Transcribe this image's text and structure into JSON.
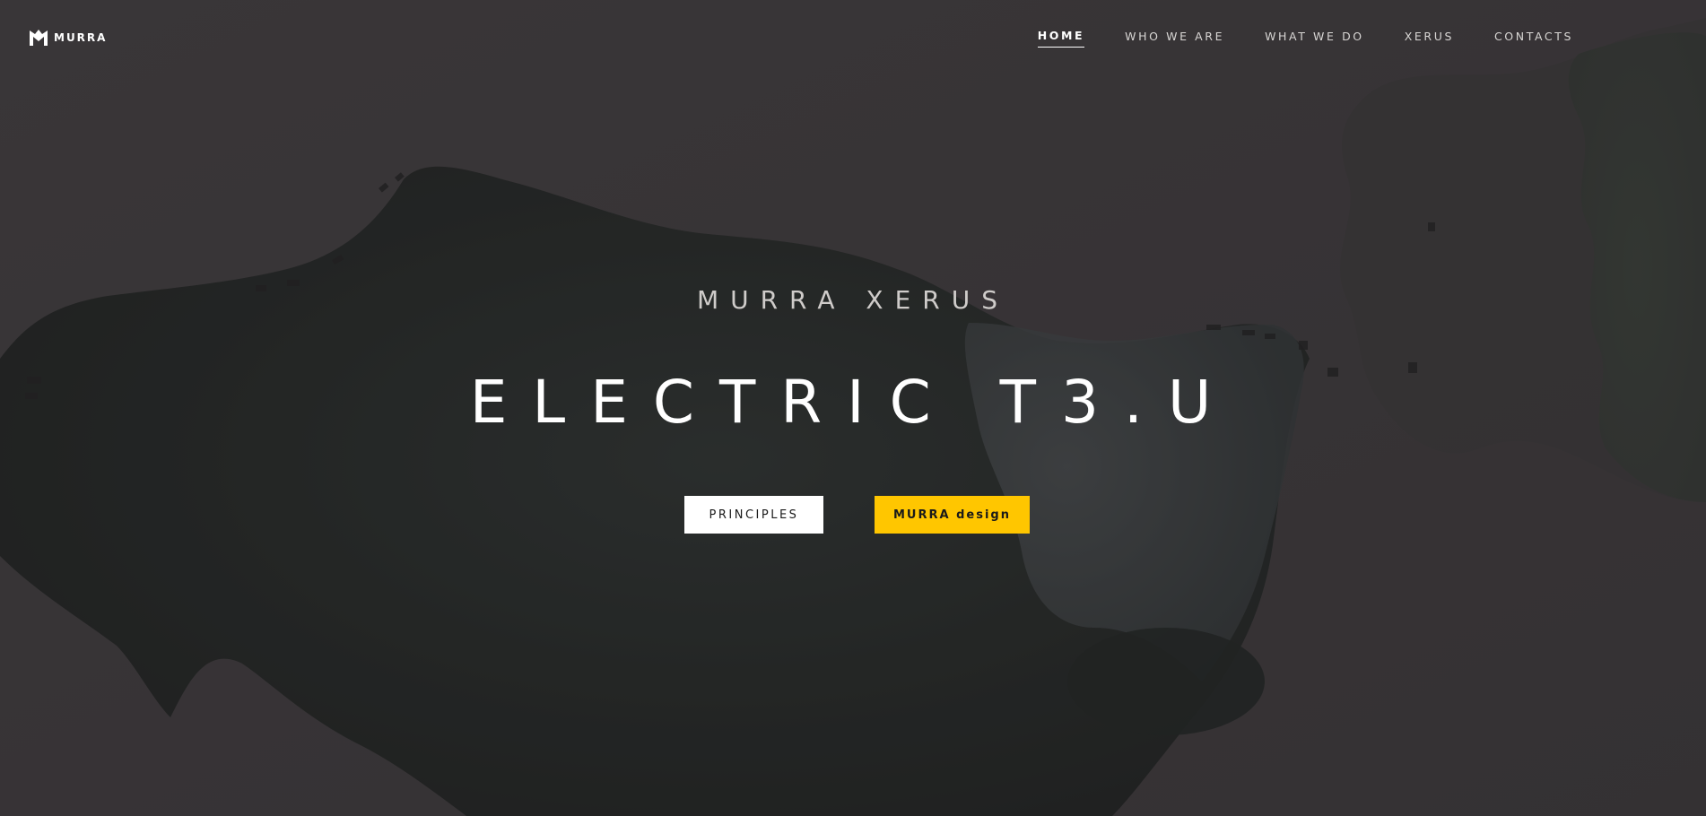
{
  "brand": {
    "logo_icon": "murra-m-logo-icon",
    "name": "MURRA"
  },
  "nav": {
    "items": [
      {
        "label": "HOME",
        "active": true
      },
      {
        "label": "WHO WE ARE",
        "active": false
      },
      {
        "label": "WHAT WE DO",
        "active": false
      },
      {
        "label": "XERUS",
        "active": false
      },
      {
        "label": "CONTACTS",
        "active": false
      }
    ]
  },
  "hero": {
    "subtitle": "MURRA XERUS",
    "title": "ELECTRIC T3.U",
    "primary_button": "PRINCIPLES",
    "secondary_button": "MURRA design",
    "background": "aerial-lake-photo"
  },
  "colors": {
    "accent_yellow": "#ffc600",
    "text_white": "#ffffff",
    "overlay": "#2a282a"
  }
}
